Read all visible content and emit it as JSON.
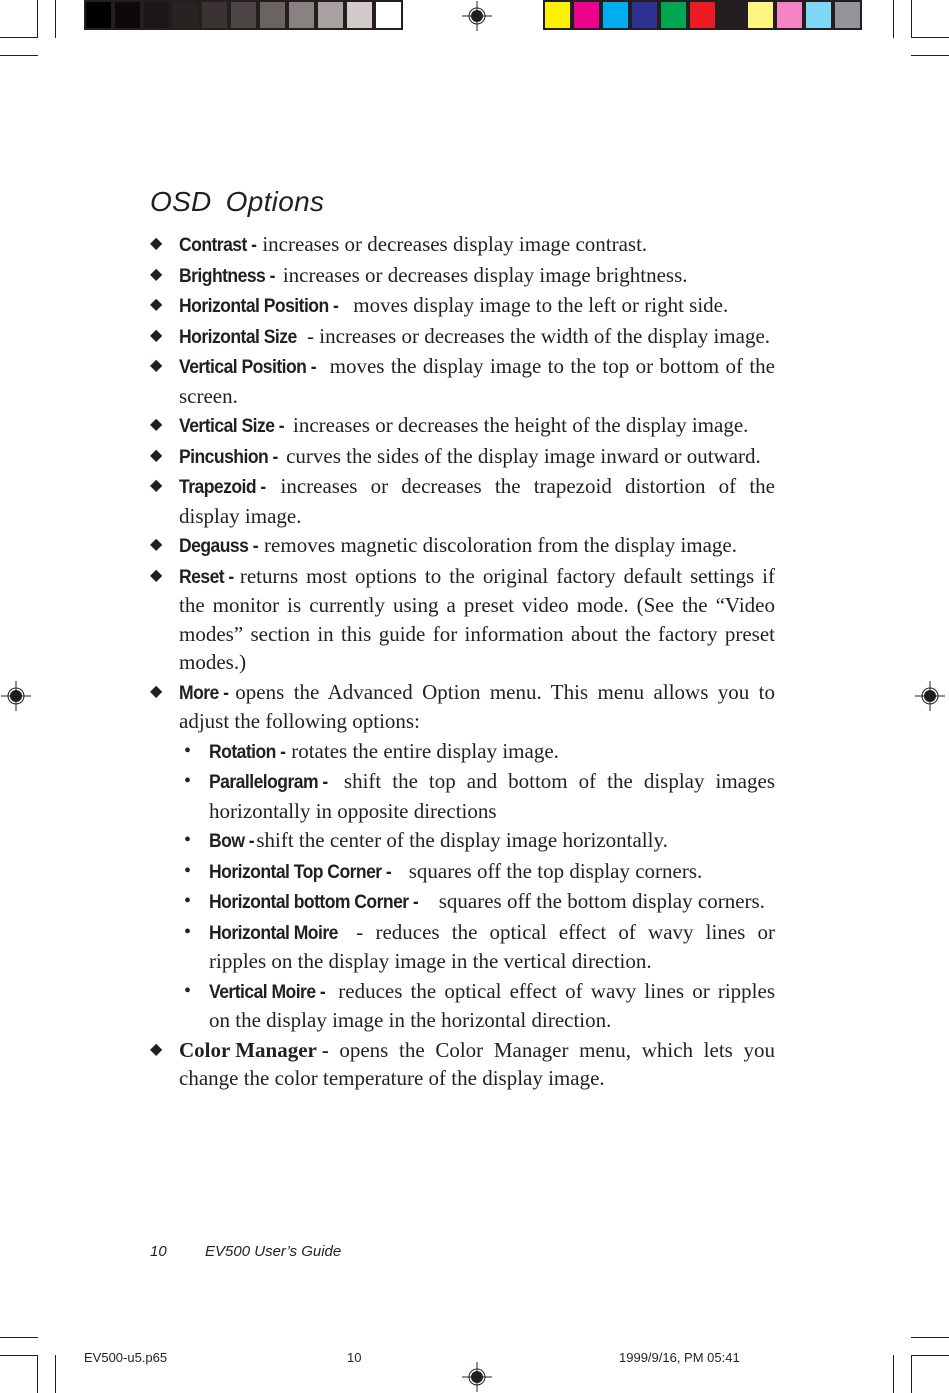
{
  "print_marks": {
    "gray_ramp": [
      "#000000",
      "#0c0a09",
      "#1a1716",
      "#282220",
      "#3b3331",
      "#4e4644",
      "#6b6361",
      "#8a8281",
      "#a9a19f",
      "#d3cbc9",
      "#ffffff"
    ],
    "color_bar": [
      "#fff200",
      "#ec008c",
      "#00aeef",
      "#2e3192",
      "#00a651",
      "#ed1c24",
      "#231f20",
      "#fff57f",
      "#f683c5",
      "#7fd7f7",
      "#939598"
    ]
  },
  "page": {
    "title": "OSD  Options",
    "items": [
      {
        "term": "Contrast -",
        "desc": " increases or decreases display image contrast."
      },
      {
        "term": "Brightness -",
        "desc": " increases or decreases display image brightness."
      },
      {
        "term": "Horizontal Position -",
        "desc": " moves display image to the left or right side."
      },
      {
        "term": "Horizontal Size",
        "desc": " - increases or decreases the width of the display image."
      },
      {
        "term": "Vertical Position -",
        "desc": " moves the display image to the top or bottom of the  screen."
      },
      {
        "term": "Vertical Size -",
        "desc": " increases or decreases the height of the display image."
      },
      {
        "term": "Pincushion -",
        "desc": " curves the sides of the display image inward or outward."
      },
      {
        "term": "Trapezoid -",
        "desc": " increases or decreases the trapezoid distortion of the display image."
      },
      {
        "term": "Degauss -",
        "desc": " removes magnetic discoloration from the display image."
      },
      {
        "term": "Reset -",
        "desc": " returns most options to the original factory default settings if the monitor is currently using a preset video mode. (See the “Video modes” section in this guide for information about the factory preset modes.)"
      },
      {
        "term": "More -",
        "desc": " opens the Advanced Option menu. This menu allows you to adjust the following options:"
      }
    ],
    "sub_items": [
      {
        "term": "Rotation -",
        "desc": " rotates the entire display image."
      },
      {
        "term": "Parallelogram -",
        "desc": " shift the top and bottom of the display images horizontally in opposite directions"
      },
      {
        "term": "Bow -",
        "desc": " shift the center of the display image horizontally."
      },
      {
        "term": "Horizontal Top Corner -",
        "desc": " squares off the top display corners."
      },
      {
        "term": "Horizontal bottom Corner -",
        "desc": " squares off the bottom display corners."
      },
      {
        "term": "Horizontal Moire",
        "desc": " - reduces the optical effect of wavy lines or ripples on the display image in the vertical direction."
      },
      {
        "term": "Vertical Moire -",
        "desc": " reduces the optical effect of wavy lines or ripples on the display image in the horizontal direction."
      }
    ],
    "last_item": {
      "term": "Color Manager -",
      "desc": " opens the Color Manager menu, which lets you change the color temperature of the display image."
    },
    "diamond_marker": "◆",
    "bullet_marker": "•"
  },
  "footer": {
    "page_number": "10",
    "guide_title": "EV500 User’s Guide"
  },
  "slug": {
    "filename": "EV500-u5.p65",
    "page": "10",
    "timestamp": "1999/9/16, PM 05:41"
  }
}
